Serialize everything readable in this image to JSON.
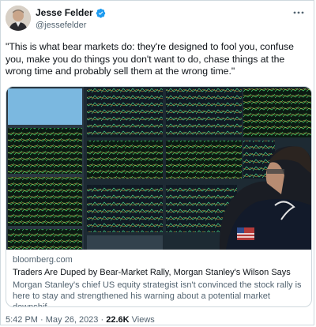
{
  "author": {
    "name": "Jesse Felder",
    "handle": "@jessefelder",
    "avatar_icon": "person-photo",
    "verified_color": "#1d9bf0"
  },
  "tweet": {
    "text": "\"This is what bear markets do: they're designed to fool you, confuse you, make you do things you don't want to do, chase things at the wrong time and probably sell them at the wrong time.\""
  },
  "link_card": {
    "media_description_icon": "trading-desk-photo",
    "domain": "bloomberg.com",
    "headline": "Traders Are Duped by Bear-Market Rally, Morgan Stanley's Wilson Says",
    "description": "Morgan Stanley's chief US equity strategist isn't convinced the stock rally is here to stay and strengthened his warning about a potential market downshif..."
  },
  "footer": {
    "time": "5:42 PM",
    "separator": "·",
    "date": "May 26, 2023",
    "views_count": "22.6K",
    "views_label": "Views"
  },
  "colors": {
    "text": "#0f1419",
    "secondary": "#536471",
    "border": "#cfd9de"
  }
}
